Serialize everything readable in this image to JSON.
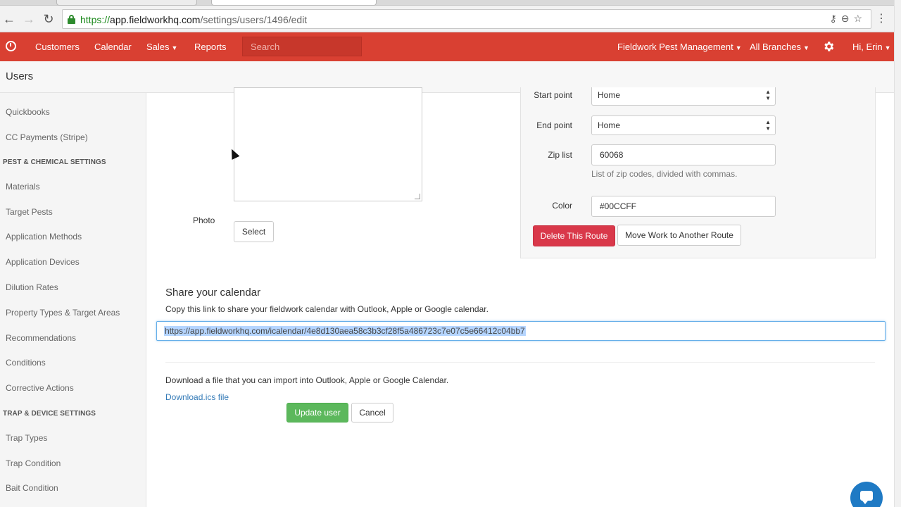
{
  "browser": {
    "url_scheme": "https://",
    "url_host": "app.fieldworkhq.com",
    "url_path": "/settings/users/1496/edit"
  },
  "topnav": {
    "items": [
      "Customers",
      "Calendar",
      "Sales",
      "Reports"
    ],
    "search_placeholder": "Search",
    "company": "Fieldwork Pest Management",
    "branches": "All Branches",
    "user": "Hi, Erin"
  },
  "page": {
    "title": "Users"
  },
  "sidebar": {
    "items": [
      {
        "label": "Quickbooks",
        "type": "link"
      },
      {
        "label": "CC Payments (Stripe)",
        "type": "link"
      },
      {
        "label": "PEST & CHEMICAL SETTINGS",
        "type": "heading"
      },
      {
        "label": "Materials",
        "type": "link"
      },
      {
        "label": "Target Pests",
        "type": "link"
      },
      {
        "label": "Application Methods",
        "type": "link"
      },
      {
        "label": "Application Devices",
        "type": "link"
      },
      {
        "label": "Dilution Rates",
        "type": "link"
      },
      {
        "label": "Property Types & Target Areas",
        "type": "link"
      },
      {
        "label": "Recommendations",
        "type": "link"
      },
      {
        "label": "Conditions",
        "type": "link"
      },
      {
        "label": "Corrective Actions",
        "type": "link"
      },
      {
        "label": "TRAP & DEVICE SETTINGS",
        "type": "heading"
      },
      {
        "label": "Trap Types",
        "type": "link"
      },
      {
        "label": "Trap Condition",
        "type": "link"
      },
      {
        "label": "Bait Condition",
        "type": "link"
      }
    ]
  },
  "form": {
    "photo_label": "Photo",
    "select_button": "Select"
  },
  "route": {
    "start_label": "Start point",
    "start_value": "Home",
    "end_label": "End point",
    "end_value": "Home",
    "zip_label": "Zip list",
    "zip_value": "60068",
    "zip_help": "List of zip codes, divided with commas.",
    "color_label": "Color",
    "color_value": "#00CCFF",
    "delete_button": "Delete This Route",
    "move_button": "Move Work to Another Route"
  },
  "share": {
    "title": "Share your calendar",
    "description": "Copy this link to share your fieldwork calendar with Outlook, Apple or Google calendar.",
    "link": "https://app.fieldworkhq.com/icalendar/4e8d130aea58c3b3cf28f5a486723c7e07c5e66412c04bb7",
    "download_description": "Download a file that you can import into Outlook, Apple or Google Calendar.",
    "download_link": "Download.ics file"
  },
  "actions": {
    "update": "Update user",
    "cancel": "Cancel"
  },
  "colors": {
    "brand": "#d94032",
    "danger": "#d9384a",
    "success": "#5cb85c",
    "link": "#337ab7",
    "chat": "#1f7ac4"
  },
  "icons": [
    "lock-icon",
    "back-icon",
    "forward-icon",
    "reload-icon",
    "key-icon",
    "zoom-icon",
    "star-icon",
    "menu-icon",
    "logo-icon",
    "gear-icon",
    "chat-icon"
  ]
}
